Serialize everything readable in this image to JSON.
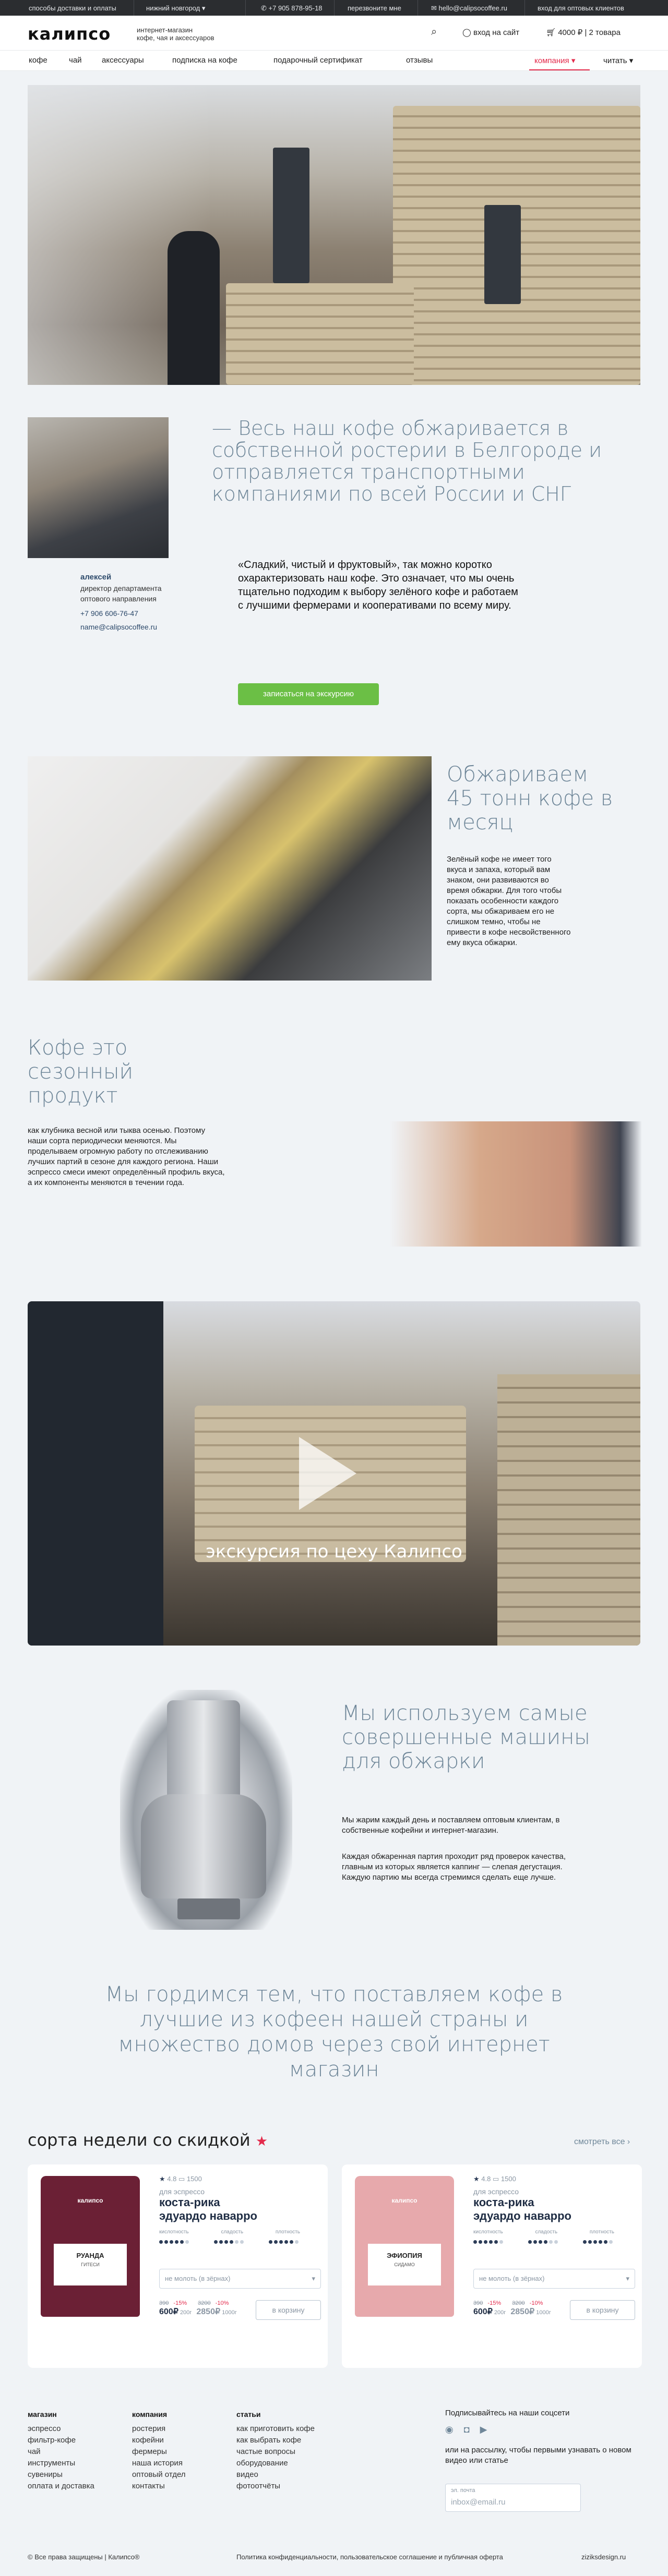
{
  "topbar": {
    "delivery": "способы доставки и оплаты",
    "city": "нижний новгород",
    "phone": "+7 905 878-95-18",
    "callback": "перезвоните мне",
    "email": "hello@calipsocoffee.ru",
    "wholesale": "вход для оптовых клиентов"
  },
  "header": {
    "logo": "калипсо",
    "tagline1": "интернет-магазин",
    "tagline2": "кофе, чая и аксессуаров",
    "login": "вход на сайт",
    "cart": "4000 ₽ | 2 товара"
  },
  "nav": {
    "items": [
      "кофе",
      "чай",
      "аксессуары",
      "подписка на кофе",
      "подарочный сертификат",
      "отзывы"
    ],
    "company": "компания",
    "read": "читать"
  },
  "about": {
    "headline": "— Весь наш кофе обжаривается в собственной ростерии в Белгороде и отправляется транспортными компаниями по всей России и СНГ",
    "quote": "«Сладкий, чистый и фруктовый», так можно коротко охарактеризовать наш кофе. Это означает, что мы очень тщательно подходим к выбору зелёного кофе и работаем с лучшими фермерами и кооперативами по всему миру.",
    "button": "записаться на экскурсию",
    "person": {
      "name": "алексей",
      "role1": "директор департамента",
      "role2": "оптового направления",
      "phone": "+7 906 606-76-47",
      "email": "name@calipsocoffee.ru"
    }
  },
  "roast": {
    "headline": "Обжариваем 45 тонн кофе в месяц",
    "text": "Зелёный кофе не имеет того вкуса и запаха, который вам знаком, они развиваются во время обжарки. Для того чтобы показать особенности каждого сорта, мы обжариваем его не слишком темно, чтобы не привести в кофе несвойственного ему вкуса обжарки."
  },
  "season": {
    "headline": "Кофе это сезонный продукт",
    "text": "как клубника весной или тыква осенью. Поэтому наши сорта периодически меняются. Мы проделываем огромную работу по отслеживанию лучших партий в сезоне для каждого региона. Наши эспрессо смеси имеют определённый профиль вкуса, а их компоненты меняются в течении года."
  },
  "video": {
    "caption": "экскурсия по цеху Калипсо"
  },
  "machines": {
    "headline": "Мы используем самые совершенные машины для обжарки",
    "text1": "Мы жарим каждый день и поставляем оптовым клиентам, в собственные кофейни и интернет-магазин.",
    "text2": "Каждая обжаренная партия проходит ряд проверок качества, главным из которых является каппинг — слепая дегустация. Каждую партию мы всегда стремимся сделать еще лучше."
  },
  "proud": {
    "text": "Мы гордимся тем, что поставляем кофе в лучшие из кофеен нашей страны и множество домов через свой интернет магазин"
  },
  "deals": {
    "title": "сорта недели со скидкой",
    "see_all": "смотреть все",
    "products": [
      {
        "rating": "4.8",
        "reviews": "1500",
        "for": "для эспрессо",
        "name1": "коста-рика",
        "name2": "эдуардо наварро",
        "pack_title": "РУАНДА",
        "pack_sub": "ГИТЕСИ",
        "labels": [
          "кислотность",
          "сладость",
          "плотность"
        ],
        "select": "не молоть (в зёрнах)",
        "old1": "390",
        "disc1": "-15%",
        "price1": "600₽",
        "unit1": "200г",
        "old2": "3200",
        "disc2": "-10%",
        "price2": "2850₽",
        "unit2": "1000г",
        "cart": "в корзину",
        "pack_color": "#6b2035"
      },
      {
        "rating": "4.8",
        "reviews": "1500",
        "for": "для эспрессо",
        "name1": "коста-рика",
        "name2": "эдуардо наварро",
        "pack_title": "ЭФИОПИЯ",
        "pack_sub": "СИДАМО",
        "labels": [
          "кислотность",
          "сладость",
          "плотность"
        ],
        "select": "не молоть (в зёрнах)",
        "old1": "390",
        "disc1": "-15%",
        "price1": "600₽",
        "unit1": "200г",
        "old2": "3200",
        "disc2": "-10%",
        "price2": "2850₽",
        "unit2": "1000г",
        "cart": "в корзину",
        "pack_color": "#e7a9ac"
      }
    ]
  },
  "footer": {
    "shops": {
      "title": "магазин",
      "items": [
        "эспрессо",
        "фильтр-кофе",
        "чай",
        "инструменты",
        "сувениры",
        "оплата и доставка"
      ]
    },
    "company": {
      "title": "компания",
      "items": [
        "ростерия",
        "кофейни",
        "фермеры",
        "наша история",
        "оптовый отдел",
        "контакты"
      ]
    },
    "articles": {
      "title": "статьи",
      "items": [
        "как приготовить кофе",
        "как выбрать кофе",
        "частые вопросы",
        "оборудование",
        "видео",
        "фотоотчёты"
      ]
    },
    "social_title": "Подписывайтесь на наши соцсети",
    "subscribe": "или на рассылку, чтобы первыми узнавать о новом видео или статье",
    "email_label": "эл. почта",
    "email_placeholder": "inbox@email.ru",
    "copyright": "© Все права защищены | Калипсо®",
    "policy": "Политика конфиденциальности, пользовательское соглашение и публичная оферта",
    "designer": "ziziksdesign.ru"
  },
  "colors": {
    "accent": "#e32a4b",
    "heading": "#6f8799",
    "button": "#6bbf45",
    "topbar": "#2b2d30"
  }
}
